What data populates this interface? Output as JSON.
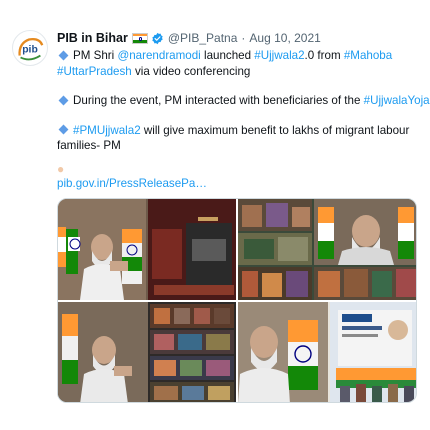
{
  "tweet": {
    "author_name": "PIB in Bihar",
    "handle": "@PIB_Patna",
    "separator": "·",
    "date": "Aug 10, 2021",
    "avatar_icon": "pib-logo-icon",
    "flag_icon": "india-flag-icon",
    "verified_icon": "verified-badge-icon",
    "lines": {
      "l1_pre": "PM Shri ",
      "l1_mention": "@narendramodi",
      "l1_mid": " launched ",
      "l1_tag": "#Ujjwala2",
      "l1_mid2": ".0 from ",
      "l1_tag2": "#Mahoba",
      "l2_tag": "#UttarPradesh",
      "l2_rest": " via video conferencing",
      "l3_pre": "During the event, PM interacted with beneficiaries of the ",
      "l3_tag": "#UjjwalaYojana",
      "l4_tag": "#PMUjjwala2",
      "l4_rest": " will give maximum benefit to lakhs of migrant labour",
      "l5": "families- PM"
    },
    "link_text": "pib.gov.in/PressReleasePa…"
  },
  "colors": {
    "link": "#1d9bf0",
    "text": "#0f1419",
    "muted": "#536471",
    "bullet": "#5e9ce6"
  },
  "media": {
    "photos": [
      "photo-pm-addressing",
      "photo-beneficiary-collage",
      "photo-pm-video-conference",
      "photo-pm-with-stage-backdrop"
    ]
  }
}
